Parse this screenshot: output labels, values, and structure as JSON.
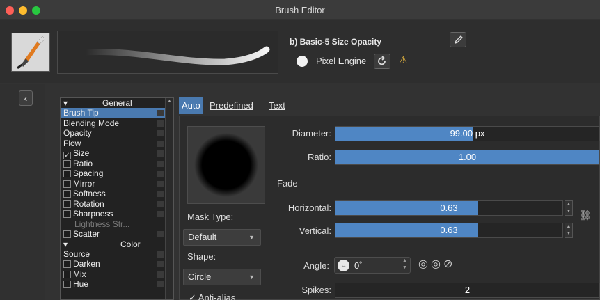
{
  "window": {
    "title": "Brush Editor"
  },
  "header": {
    "brush_name": "b) Basic-5 Size Opacity",
    "engine": "Pixel Engine",
    "warning_icon": "warning-icon"
  },
  "options_list": {
    "general_header": "General",
    "items": [
      {
        "label": "Brush Tip",
        "checkbox": false,
        "selected": true
      },
      {
        "label": "Blending Mode",
        "checkbox": false
      },
      {
        "label": "Opacity",
        "checkbox": false
      },
      {
        "label": "Flow",
        "checkbox": false
      },
      {
        "label": "Size",
        "checkbox": true,
        "checked": true
      },
      {
        "label": "Ratio",
        "checkbox": true,
        "checked": false
      },
      {
        "label": "Spacing",
        "checkbox": true,
        "checked": false
      },
      {
        "label": "Mirror",
        "checkbox": true,
        "checked": false
      },
      {
        "label": "Softness",
        "checkbox": true,
        "checked": false
      },
      {
        "label": "Rotation",
        "checkbox": true,
        "checked": false
      },
      {
        "label": "Sharpness",
        "checkbox": true,
        "checked": false
      },
      {
        "label": "Lightness Str...",
        "checkbox": false,
        "dim": true
      },
      {
        "label": "Scatter",
        "checkbox": true,
        "checked": false
      }
    ],
    "color_header": "Color",
    "items2": [
      {
        "label": "Source",
        "checkbox": false
      },
      {
        "label": "Darken",
        "checkbox": true,
        "checked": false
      },
      {
        "label": "Mix",
        "checkbox": true,
        "checked": false
      },
      {
        "label": "Hue",
        "checkbox": true,
        "checked": false
      }
    ]
  },
  "tabs": [
    {
      "label": "Auto",
      "active": true
    },
    {
      "label": "Predefined",
      "active": false
    },
    {
      "label": "Text",
      "active": false
    }
  ],
  "mask": {
    "mask_type_label": "Mask Type:",
    "mask_type_value": "Default",
    "shape_label": "Shape:",
    "shape_value": "Circle",
    "antialias_label": "Anti-alias"
  },
  "params": {
    "diameter_label": "Diameter:",
    "diameter_value": "99.00 px",
    "diameter_fill": 0.52,
    "ratio_label": "Ratio:",
    "ratio_value": "1.00",
    "ratio_fill": 1.0,
    "fade_label": "Fade",
    "horizontal_label": "Horizontal:",
    "horizontal_value": "0.63",
    "horizontal_fill": 0.63,
    "vertical_label": "Vertical:",
    "vertical_value": "0.63",
    "vertical_fill": 0.63,
    "angle_label": "Angle:",
    "angle_value": "0˚",
    "spikes_label": "Spikes:",
    "spikes_value": "2",
    "spikes_fill": 0.0
  },
  "colors": {
    "accent": "#4f86c4",
    "selection": "#4a7ab0"
  }
}
